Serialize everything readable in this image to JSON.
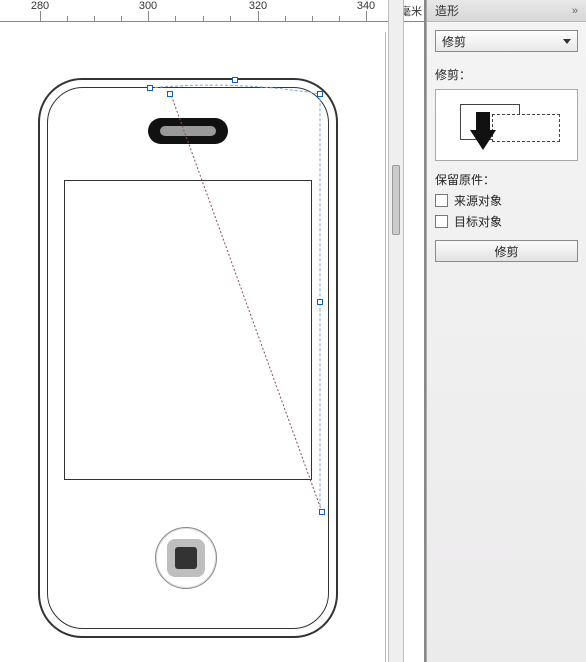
{
  "ruler": {
    "labels": [
      "280",
      "300",
      "320",
      "340"
    ],
    "positions": [
      40,
      148,
      258,
      366
    ],
    "units": "毫米"
  },
  "panel": {
    "title": "造形",
    "close_glyph": "»",
    "operation_select": "修剪",
    "preview_label": "修剪：",
    "keep_label": "保留原件：",
    "checkbox_source": "来源对象",
    "checkbox_target": "目标对象",
    "apply_label": "修剪"
  }
}
